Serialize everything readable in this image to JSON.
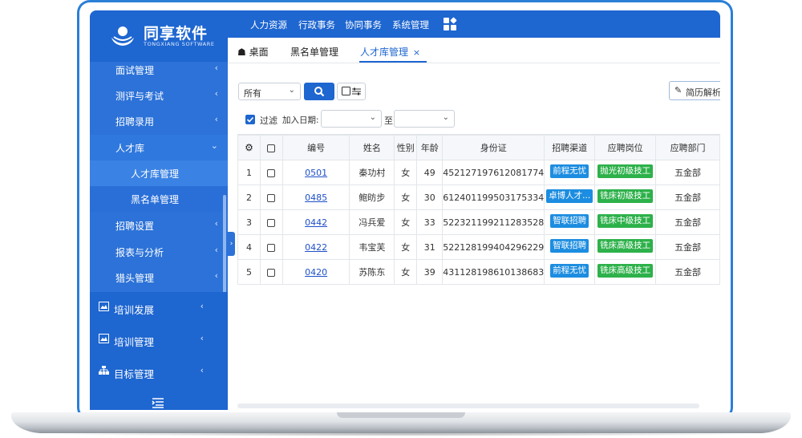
{
  "brand": {
    "name": "同享软件",
    "subtitle": "TONGXIANG SOFTWARE"
  },
  "top_nav": [
    "人力资源",
    "行政事务",
    "协同事务",
    "系统管理"
  ],
  "tabs": [
    {
      "label": "桌面",
      "icon": "home-icon"
    },
    {
      "label": "黑名单管理"
    },
    {
      "label": "人才库管理",
      "active": true,
      "closable": true
    }
  ],
  "sidebar": {
    "sub_items": [
      {
        "label": "面试管理",
        "expanded": false
      },
      {
        "label": "测评与考试",
        "expanded": false
      },
      {
        "label": "招聘录用",
        "expanded": false
      },
      {
        "label": "人才库",
        "expanded": true
      },
      {
        "label": "人才库管理",
        "level": 2,
        "active": true
      },
      {
        "label": "黑名单管理",
        "level": 2
      },
      {
        "label": "招聘设置",
        "expanded": false
      },
      {
        "label": "报表与分析",
        "expanded": false
      },
      {
        "label": "猎头管理",
        "expanded": false
      }
    ],
    "main_items": [
      {
        "label": "培训发展",
        "icon": "image-icon"
      },
      {
        "label": "培训管理",
        "icon": "image-icon"
      },
      {
        "label": "目标管理",
        "icon": "sitemap-icon"
      }
    ]
  },
  "toolbar": {
    "select_value": "所有",
    "parse_button": "简历解析",
    "filter_label": "过滤",
    "date_label": "加入日期:",
    "to_label": "至"
  },
  "table": {
    "columns": [
      "",
      "",
      "编号",
      "姓名",
      "性别",
      "年龄",
      "身份证",
      "招聘渠道",
      "应聘岗位",
      "应聘部门"
    ],
    "rows": [
      {
        "n": "1",
        "id": "0501",
        "name": "秦功村",
        "gender": "女",
        "age": "49",
        "idcard": "452127197612081774",
        "channel": "前程无忧",
        "position": "抛光初级技工",
        "dept": "五金部"
      },
      {
        "n": "2",
        "id": "0485",
        "name": "鲍昉步",
        "gender": "女",
        "age": "30",
        "idcard": "612401199503175334",
        "channel": "卓博人才...",
        "position": "铣床初级技工",
        "dept": "五金部"
      },
      {
        "n": "3",
        "id": "0442",
        "name": "冯兵爱",
        "gender": "女",
        "age": "33",
        "idcard": "522321199211283528",
        "channel": "智联招聘",
        "position": "铣床中级技工",
        "dept": "五金部"
      },
      {
        "n": "4",
        "id": "0422",
        "name": "韦宝芙",
        "gender": "女",
        "age": "31",
        "idcard": "522128199404296229",
        "channel": "智联招聘",
        "position": "铣床高级技工",
        "dept": "五金部"
      },
      {
        "n": "5",
        "id": "0420",
        "name": "苏陈东",
        "gender": "女",
        "age": "39",
        "idcard": "431128198610138683",
        "channel": "前程无忧",
        "position": "铣床高级技工",
        "dept": "五金部"
      }
    ]
  },
  "colors": {
    "primary": "#1e66d0",
    "badge_blue": "#1c8de0",
    "badge_green": "#2db14a"
  }
}
